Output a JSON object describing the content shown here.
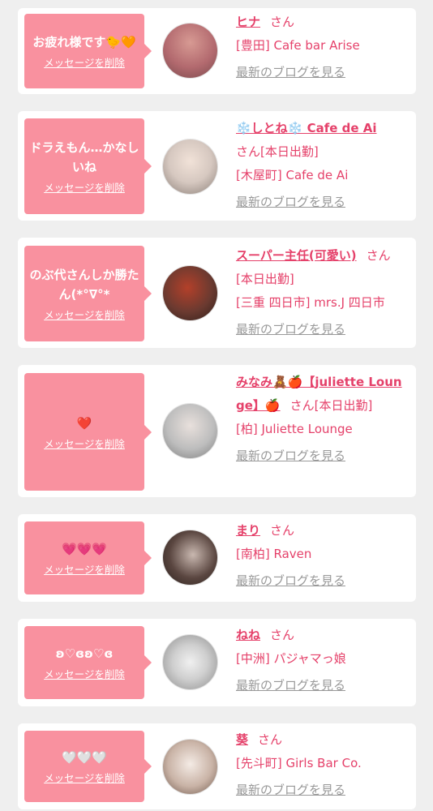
{
  "items": [
    {
      "message": "お疲れ様です🐤🧡",
      "delete_label": "メッセージを削除",
      "name": "ヒナ",
      "san": "さん",
      "status": "",
      "shop": "[豊田] Cafe bar Arise",
      "blog": "最新のブログを見る",
      "avatar_color": "#b36a6f"
    },
    {
      "message": "ドラえもん…かなしいね",
      "delete_label": "メッセージを削除",
      "name": "❄️しとね❄️ Cafe de Ai",
      "san": "さん",
      "status": "[本日出勤]",
      "shop": "[木屋町] Cafe de Ai",
      "blog": "最新のブログを見る",
      "avatar_color": "#d6c8c0"
    },
    {
      "message": "のぶ代さんしか勝たん(*°∇°*",
      "delete_label": "メッセージを削除",
      "name": "スーパー主任(可愛い)",
      "san": "さん",
      "status": "[本日出勤]",
      "shop": "[三重 四日市] mrs.J 四日市",
      "blog": "最新のブログを見る",
      "avatar_color": "#6b3a30"
    },
    {
      "message": "❤️",
      "delete_label": "メッセージを削除",
      "name": "みなみ🧸🍎【juliette Lounge】🍎",
      "san": "さん",
      "status": "[本日出勤]",
      "shop": "[柏] Juliette Lounge",
      "blog": "最新のブログを見る",
      "avatar_color": "#bdbdbd"
    },
    {
      "message": "💗💗💗",
      "delete_label": "メッセージを削除",
      "name": "まり",
      "san": "さん",
      "status": "",
      "shop": "[南柏] Raven",
      "blog": "最新のブログを見る",
      "avatar_color": "#5a4640"
    },
    {
      "message": "ʚ♡ɞʚ♡ɞ",
      "delete_label": "メッセージを削除",
      "name": "ねね",
      "san": "さん",
      "status": "",
      "shop": "[中洲] パジャマっ娘",
      "blog": "最新のブログを見る",
      "avatar_color": "#9a9a9a"
    },
    {
      "message": "🤍🤍🤍",
      "delete_label": "メッセージを削除",
      "name": "葵",
      "san": "さん",
      "status": "",
      "shop": "[先斗町] Girls Bar Co.",
      "blog": "最新のブログを見る",
      "avatar_color": "#c9b3a6"
    }
  ]
}
